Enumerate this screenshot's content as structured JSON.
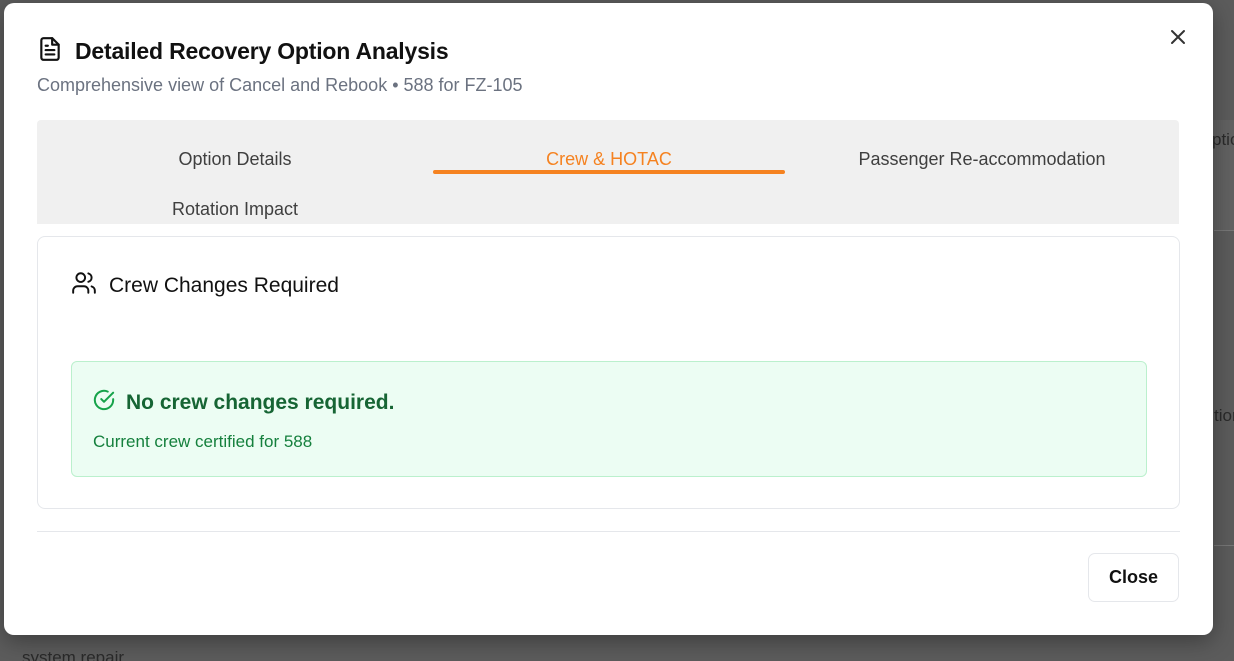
{
  "background": {
    "frag_top_right": "ptic",
    "frag_mid_right": "tion",
    "frag_bottom": "system repair"
  },
  "dialog": {
    "title": "Detailed Recovery Option Analysis",
    "subtitle": "Comprehensive view of Cancel and Rebook • 588 for FZ-105",
    "title_icon": "document-icon",
    "close_icon": "close-icon"
  },
  "tabs": [
    {
      "label": "Option Details",
      "active": false
    },
    {
      "label": "Crew & HOTAC",
      "active": true
    },
    {
      "label": "Passenger Re-accommodation",
      "active": false
    },
    {
      "label": "Rotation Impact",
      "active": false
    }
  ],
  "crew_section": {
    "title": "Crew Changes Required",
    "icon": "users-icon",
    "notice": {
      "icon": "check-circle-icon",
      "heading": "No crew changes required.",
      "detail": "Current crew certified for 588"
    }
  },
  "footer": {
    "close_label": "Close"
  },
  "colors": {
    "accent": "#f58220",
    "success_bg": "#ecfdf3",
    "success_text": "#166534",
    "overlay": "#5c5c5c"
  }
}
